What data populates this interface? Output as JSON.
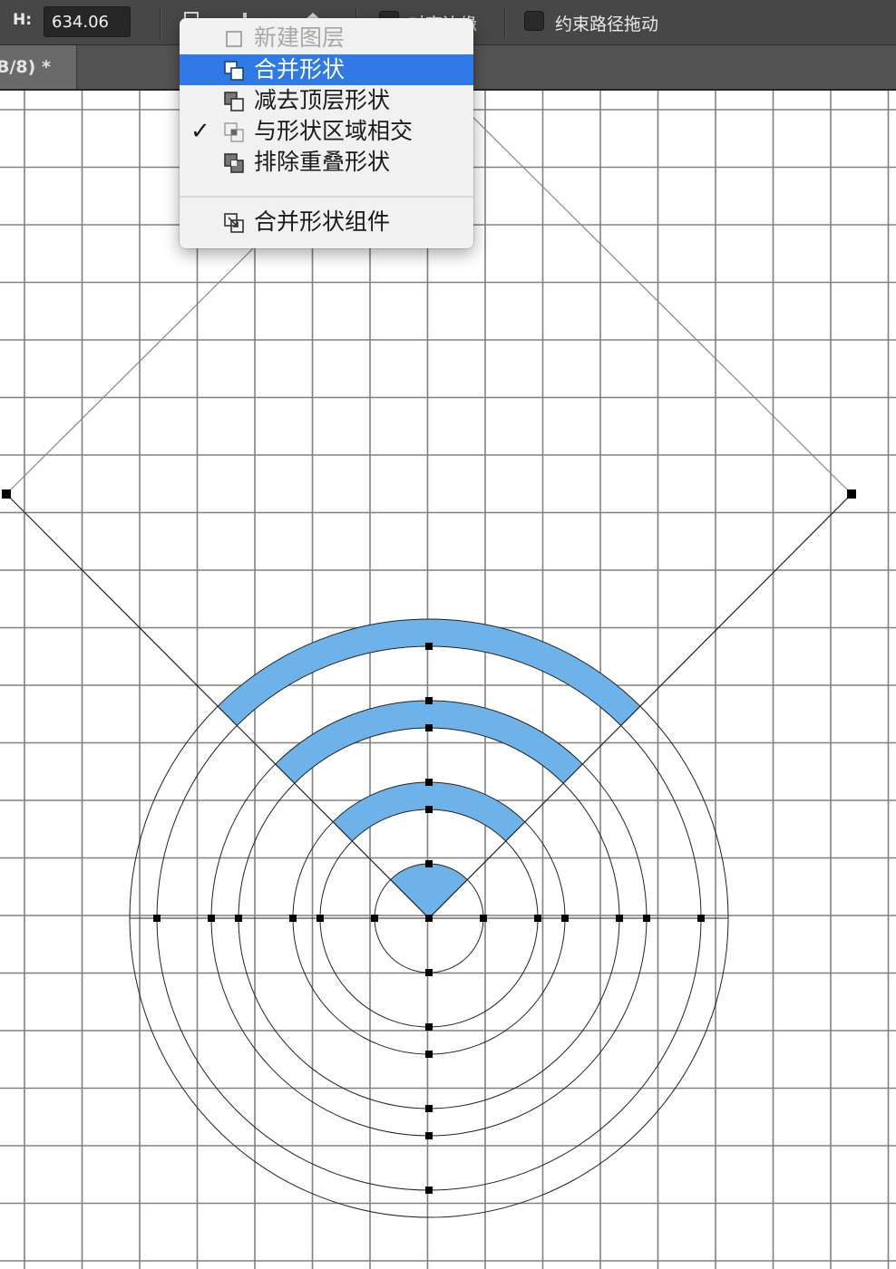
{
  "options_bar": {
    "height_label": "H:",
    "height_value": "634.06",
    "align_edges_label": "对齐边缘",
    "constrain_path_label": "约束路径拖动"
  },
  "document_tab": {
    "title": "B/8) *"
  },
  "path_operations_menu": {
    "items": [
      {
        "label": "新建图层",
        "icon": "new-layer-icon",
        "state": "disabled"
      },
      {
        "label": "合并形状",
        "icon": "combine-shapes-icon",
        "state": "highlighted"
      },
      {
        "label": "减去顶层形状",
        "icon": "subtract-front-shape-icon",
        "state": "normal"
      },
      {
        "label": "与形状区域相交",
        "icon": "intersect-shape-areas-icon",
        "state": "checked"
      },
      {
        "label": "排除重叠形状",
        "icon": "exclude-overlapping-shapes-icon",
        "state": "normal"
      },
      {
        "label": "合并形状组件",
        "icon": "merge-shape-components-icon",
        "state": "normal"
      }
    ],
    "check_mark": "✓"
  },
  "colors": {
    "wifi_fill": "#6db3ea",
    "menu_highlight": "#2f7ae5",
    "grid_line": "#808080",
    "anchor": "#000000"
  }
}
